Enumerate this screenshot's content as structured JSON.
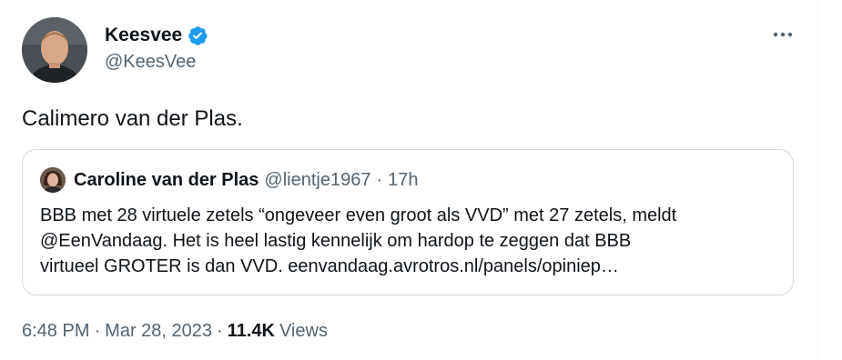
{
  "author": {
    "display_name": "Keesvee",
    "handle": "@KeesVee",
    "verified": true
  },
  "tweet": {
    "text": "Calimero van der Plas."
  },
  "quote": {
    "display_name": "Caroline van der Plas",
    "handle": "@lientje1967",
    "separator": "·",
    "time": "17h",
    "lines": [
      "BBB met 28 virtuele zetels “ongeveer even groot als VVD” met 27 zetels, meldt",
      "@EenVandaag. Het is heel lastig kennelijk om hardop te zeggen dat BBB",
      "virtueel GROTER is dan VVD. eenvandaag.avrotros.nl/panels/opiniep…"
    ]
  },
  "meta": {
    "time": "6:48 PM",
    "separator": "·",
    "date": "Mar 28, 2023",
    "views_count": "11.4K",
    "views_label": "Views"
  },
  "icons": {
    "verified": "verified-badge-icon",
    "more": "more-horizontal-icon"
  },
  "colors": {
    "verified_blue": "#1d9bf0",
    "secondary_text": "#536471",
    "primary_text": "#0f1419",
    "border": "#cfd9de"
  }
}
